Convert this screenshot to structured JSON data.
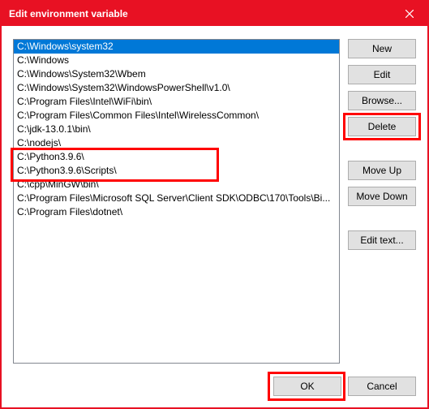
{
  "window": {
    "title": "Edit environment variable"
  },
  "paths": [
    {
      "text": "C:\\Windows\\system32",
      "selected": true
    },
    {
      "text": "C:\\Windows",
      "selected": false
    },
    {
      "text": "C:\\Windows\\System32\\Wbem",
      "selected": false
    },
    {
      "text": "C:\\Windows\\System32\\WindowsPowerShell\\v1.0\\",
      "selected": false
    },
    {
      "text": "C:\\Program Files\\Intel\\WiFi\\bin\\",
      "selected": false
    },
    {
      "text": "C:\\Program Files\\Common Files\\Intel\\WirelessCommon\\",
      "selected": false
    },
    {
      "text": "C:\\jdk-13.0.1\\bin\\",
      "selected": false
    },
    {
      "text": "C:\\nodejs\\",
      "selected": false
    },
    {
      "text": "C:\\Python3.9.6\\",
      "selected": false
    },
    {
      "text": "C:\\Python3.9.6\\Scripts\\",
      "selected": false
    },
    {
      "text": "C:\\cpp\\MinGW\\bin\\",
      "selected": false
    },
    {
      "text": "C:\\Program Files\\Microsoft SQL Server\\Client SDK\\ODBC\\170\\Tools\\Bi...",
      "selected": false
    },
    {
      "text": "C:\\Program Files\\dotnet\\",
      "selected": false
    }
  ],
  "buttons": {
    "new": "New",
    "edit": "Edit",
    "browse": "Browse...",
    "delete": "Delete",
    "moveup": "Move Up",
    "movedown": "Move Down",
    "edittext": "Edit text...",
    "ok": "OK",
    "cancel": "Cancel"
  },
  "annotations": {
    "highlight_delete": true,
    "highlight_python_rows": true,
    "highlight_ok": true
  }
}
